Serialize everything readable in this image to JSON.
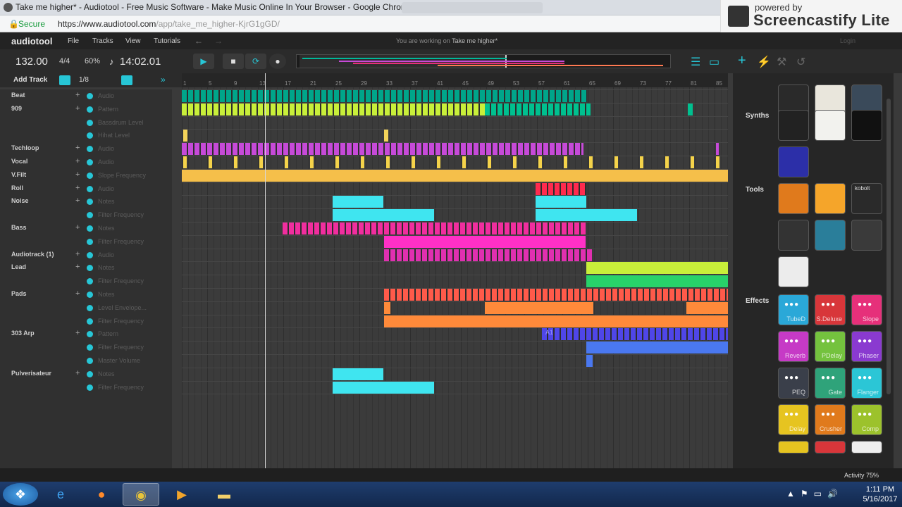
{
  "browser": {
    "title": "Take me higher* - Audiotool - Free Music Software - Make Music Online In Your Browser - Google Chrome",
    "secure_label": "Secure",
    "url_host": "https://www.audiotool.com",
    "url_path": "/app/take_me_higher-KjrG1gGD/"
  },
  "screencastify": {
    "powered": "powered by",
    "brand": "Screencastify Lite"
  },
  "app": {
    "logo": "audiotool",
    "menu": [
      "File",
      "Tracks",
      "View",
      "Tutorials"
    ],
    "working_prefix": "You are working on",
    "project": "Take me higher*",
    "login": "Login"
  },
  "transport": {
    "bpm": "132.00",
    "signature": "4/4",
    "zoom": "60%",
    "time": "14:02.01"
  },
  "tracks_bar": {
    "add_track": "Add Track",
    "grid": "1/8"
  },
  "ruler": [
    "1",
    "5",
    "9",
    "13",
    "17",
    "21",
    "25",
    "29",
    "33",
    "37",
    "41",
    "45",
    "49",
    "53",
    "57",
    "61",
    "65",
    "69",
    "73",
    "77",
    "81",
    "85"
  ],
  "tracks": [
    {
      "name": "Beat",
      "type": "Audio",
      "plus": true
    },
    {
      "name": "909",
      "type": "Pattern",
      "plus": true
    },
    {
      "name": "",
      "type": "Bassdrum Level",
      "plus": false
    },
    {
      "name": "",
      "type": "Hihat Level",
      "plus": false
    },
    {
      "name": "Techloop",
      "type": "Audio",
      "plus": true
    },
    {
      "name": "Vocal",
      "type": "Audio",
      "plus": true
    },
    {
      "name": "V.Filt",
      "type": "Slope Frequency",
      "plus": true
    },
    {
      "name": "Roll",
      "type": "Audio",
      "plus": true
    },
    {
      "name": "Noise",
      "type": "Notes",
      "plus": true
    },
    {
      "name": "",
      "type": "Filter Frequency",
      "plus": false
    },
    {
      "name": "Bass",
      "type": "Notes",
      "plus": true
    },
    {
      "name": "",
      "type": "Filter Frequency",
      "plus": false
    },
    {
      "name": "Audiotrack (1)",
      "type": "Audio",
      "plus": true
    },
    {
      "name": "Lead",
      "type": "Notes",
      "plus": true
    },
    {
      "name": "",
      "type": "Filter Frequency",
      "plus": false
    },
    {
      "name": "Pads",
      "type": "Notes",
      "plus": true
    },
    {
      "name": "",
      "type": "Level Envelope...",
      "plus": false
    },
    {
      "name": "",
      "type": "Filter Frequency",
      "plus": false
    },
    {
      "name": "303 Arp",
      "type": "Pattern",
      "plus": true
    },
    {
      "name": "",
      "type": "Filter Frequency",
      "plus": false
    },
    {
      "name": "",
      "type": "Master Volume",
      "plus": false
    },
    {
      "name": "Pulverisateur",
      "type": "Notes",
      "plus": true
    },
    {
      "name": "",
      "type": "Filter Frequency",
      "plus": false
    }
  ],
  "clip_label": "A1",
  "panel": {
    "synths": "Synths",
    "tools": "Tools",
    "effects": "Effects",
    "tool_kobolt": "kobolt",
    "effect_devices": [
      {
        "label": "TubeD",
        "color": "#2aa8d8"
      },
      {
        "label": "S.Deluxe",
        "color": "#d8363a"
      },
      {
        "label": "Slope",
        "color": "#e6307a"
      },
      {
        "label": "Reverb",
        "color": "#c63ac6"
      },
      {
        "label": "PDelay",
        "color": "#74c23e"
      },
      {
        "label": "Phaser",
        "color": "#8a3ad0"
      },
      {
        "label": "PEQ",
        "color": "#3a3f4a"
      },
      {
        "label": "Gate",
        "color": "#2fa37a"
      },
      {
        "label": "Flanger",
        "color": "#2bc6d6"
      },
      {
        "label": "Delay",
        "color": "#e6c420"
      },
      {
        "label": "Crusher",
        "color": "#e07a1c"
      },
      {
        "label": "Comp",
        "color": "#9cc22c"
      }
    ]
  },
  "activity": "Activity 75%",
  "taskbar": {
    "time": "1:11 PM",
    "date": "5/16/2017"
  }
}
